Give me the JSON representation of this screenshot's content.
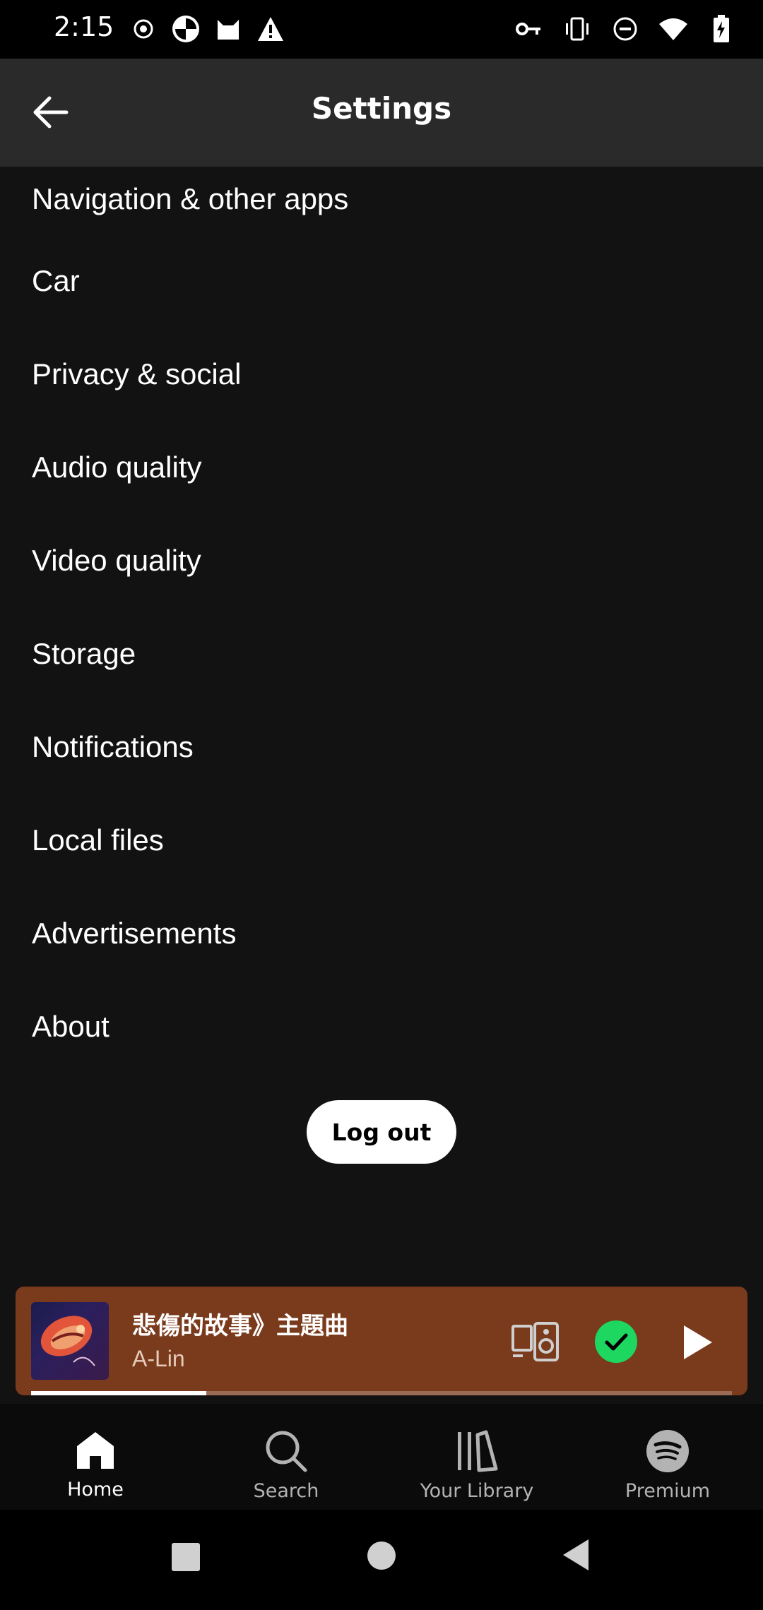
{
  "status_bar": {
    "time": "2:15",
    "left_icons": [
      "record-icon",
      "pie-app-icon",
      "cat-app-icon",
      "warning-icon"
    ],
    "right_icons": [
      "vpn-key-icon",
      "vibrate-icon",
      "do-not-disturb-icon",
      "wifi-icon",
      "battery-charging-icon"
    ]
  },
  "header": {
    "title": "Settings",
    "back_icon": "arrow-left-icon"
  },
  "settings_items": [
    "Navigation & other apps",
    "Car",
    "Privacy & social",
    "Audio quality",
    "Video quality",
    "Storage",
    "Notifications",
    "Local files",
    "Advertisements",
    "About"
  ],
  "logout_label": "Log out",
  "now_playing": {
    "title": "悲傷的故事》主題曲",
    "artist": "A-Lin",
    "progress": 0.25,
    "background_color": "#7a3b1c",
    "check_color": "#1ed760",
    "icons": [
      "connect-device-icon",
      "liked-check-icon",
      "play-icon"
    ]
  },
  "bottom_nav": [
    {
      "label": "Home",
      "icon": "home-icon",
      "active": true
    },
    {
      "label": "Search",
      "icon": "search-icon",
      "active": false
    },
    {
      "label": "Your Library",
      "icon": "library-icon",
      "active": false
    },
    {
      "label": "Premium",
      "icon": "spotify-icon",
      "active": false
    }
  ]
}
